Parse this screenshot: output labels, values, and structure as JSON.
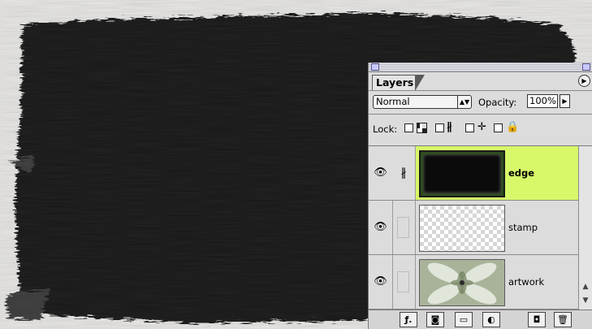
{
  "palette": {
    "tab_label": "Layers",
    "menu_icon": "palette-menu-arrow-icon",
    "blend_mode": "Normal",
    "opacity_label": "Opacity:",
    "opacity_value": "100%",
    "lock_label": "Lock:",
    "lock_icons": [
      "lock-transparent-pixels-icon",
      "lock-image-pixels-icon",
      "lock-position-icon",
      "lock-all-icon"
    ],
    "layers": [
      {
        "name": "edge",
        "active": true,
        "visible": true,
        "brush": true
      },
      {
        "name": "stamp",
        "active": false,
        "visible": true,
        "brush": false
      },
      {
        "name": "artwork",
        "active": false,
        "visible": true,
        "brush": false
      }
    ],
    "bottom_buttons": [
      "layer-style-icon",
      "layer-mask-icon",
      "new-set-icon",
      "adjustment-layer-icon",
      "new-layer-icon",
      "trash-icon"
    ]
  },
  "colors": {
    "active_layer": "#d8f86a",
    "canvas_background": "#ecebe9",
    "artwork_fill": "#151515"
  }
}
